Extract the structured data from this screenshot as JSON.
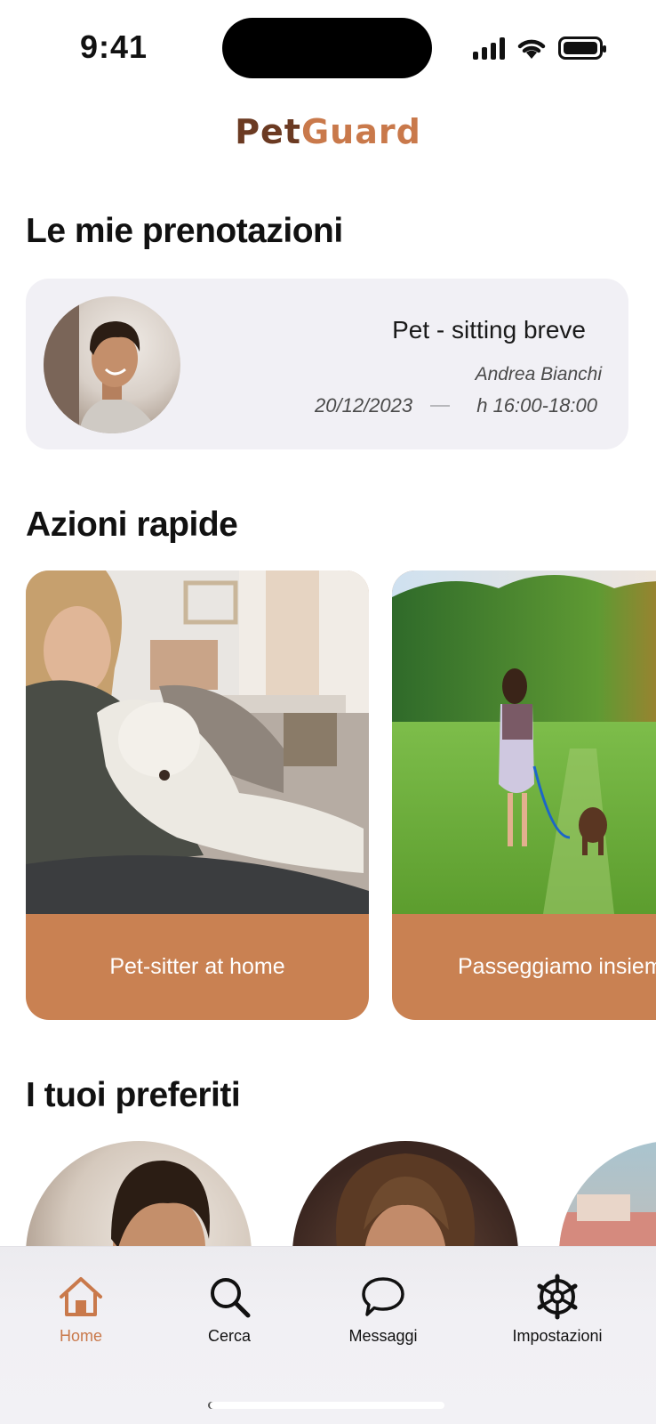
{
  "status_bar": {
    "time": "9:41"
  },
  "app": {
    "logo_part1": "Pet",
    "logo_part2": "Guard"
  },
  "bookings": {
    "title": "Le mie prenotazioni",
    "items": [
      {
        "service": "Pet - sitting breve",
        "sitter": "Andrea Bianchi",
        "date": "20/12/2023",
        "time": "h 16:00-18:00"
      }
    ]
  },
  "quick_actions": {
    "title": "Azioni rapide",
    "items": [
      {
        "label": "Pet-sitter at home"
      },
      {
        "label": "Passeggiamo insieme"
      }
    ]
  },
  "favorites": {
    "title": "I tuoi preferiti"
  },
  "tab_bar": {
    "items": [
      {
        "label": "Home",
        "icon": "home-icon",
        "active": true
      },
      {
        "label": "Cerca",
        "icon": "search-icon",
        "active": false
      },
      {
        "label": "Messaggi",
        "icon": "chat-icon",
        "active": false
      },
      {
        "label": "Impostazioni",
        "icon": "gear-icon",
        "active": false
      }
    ]
  },
  "colors": {
    "accent": "#c9794b",
    "logo_dark": "#6b3a22",
    "card_bg": "#f1f0f5"
  }
}
